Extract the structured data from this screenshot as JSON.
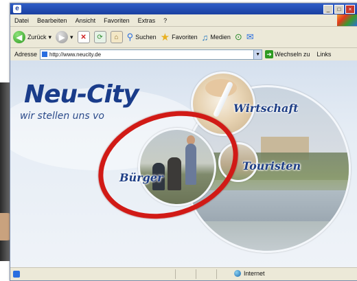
{
  "menu": {
    "items": [
      "Datei",
      "Bearbeiten",
      "Ansicht",
      "Favoriten",
      "Extras",
      "?"
    ]
  },
  "toolbar": {
    "back_label": "Zurück",
    "search_label": "Suchen",
    "favorites_label": "Favoriten",
    "media_label": "Medien"
  },
  "address": {
    "label": "Adresse",
    "value": "http://www.neucity.de",
    "go_label": "Wechseln zu",
    "links_label": "Links"
  },
  "page": {
    "logo": "Neu-City",
    "slogan": "wir stellen uns vo",
    "labels": {
      "wirtschaft": "Wirtschaft",
      "buerger": "Bürger",
      "touristen": "Touristen"
    }
  },
  "status": {
    "zone": "Internet"
  },
  "colors": {
    "brand_blue": "#1a3c8a",
    "highlight_red": "#d11a16",
    "title_bar": "#2f5dc7"
  },
  "icons": [
    "back-icon",
    "forward-icon",
    "stop-icon",
    "refresh-icon",
    "home-icon",
    "search-icon",
    "favorites-star-icon",
    "media-icon",
    "history-icon",
    "mail-icon",
    "globe-icon"
  ]
}
